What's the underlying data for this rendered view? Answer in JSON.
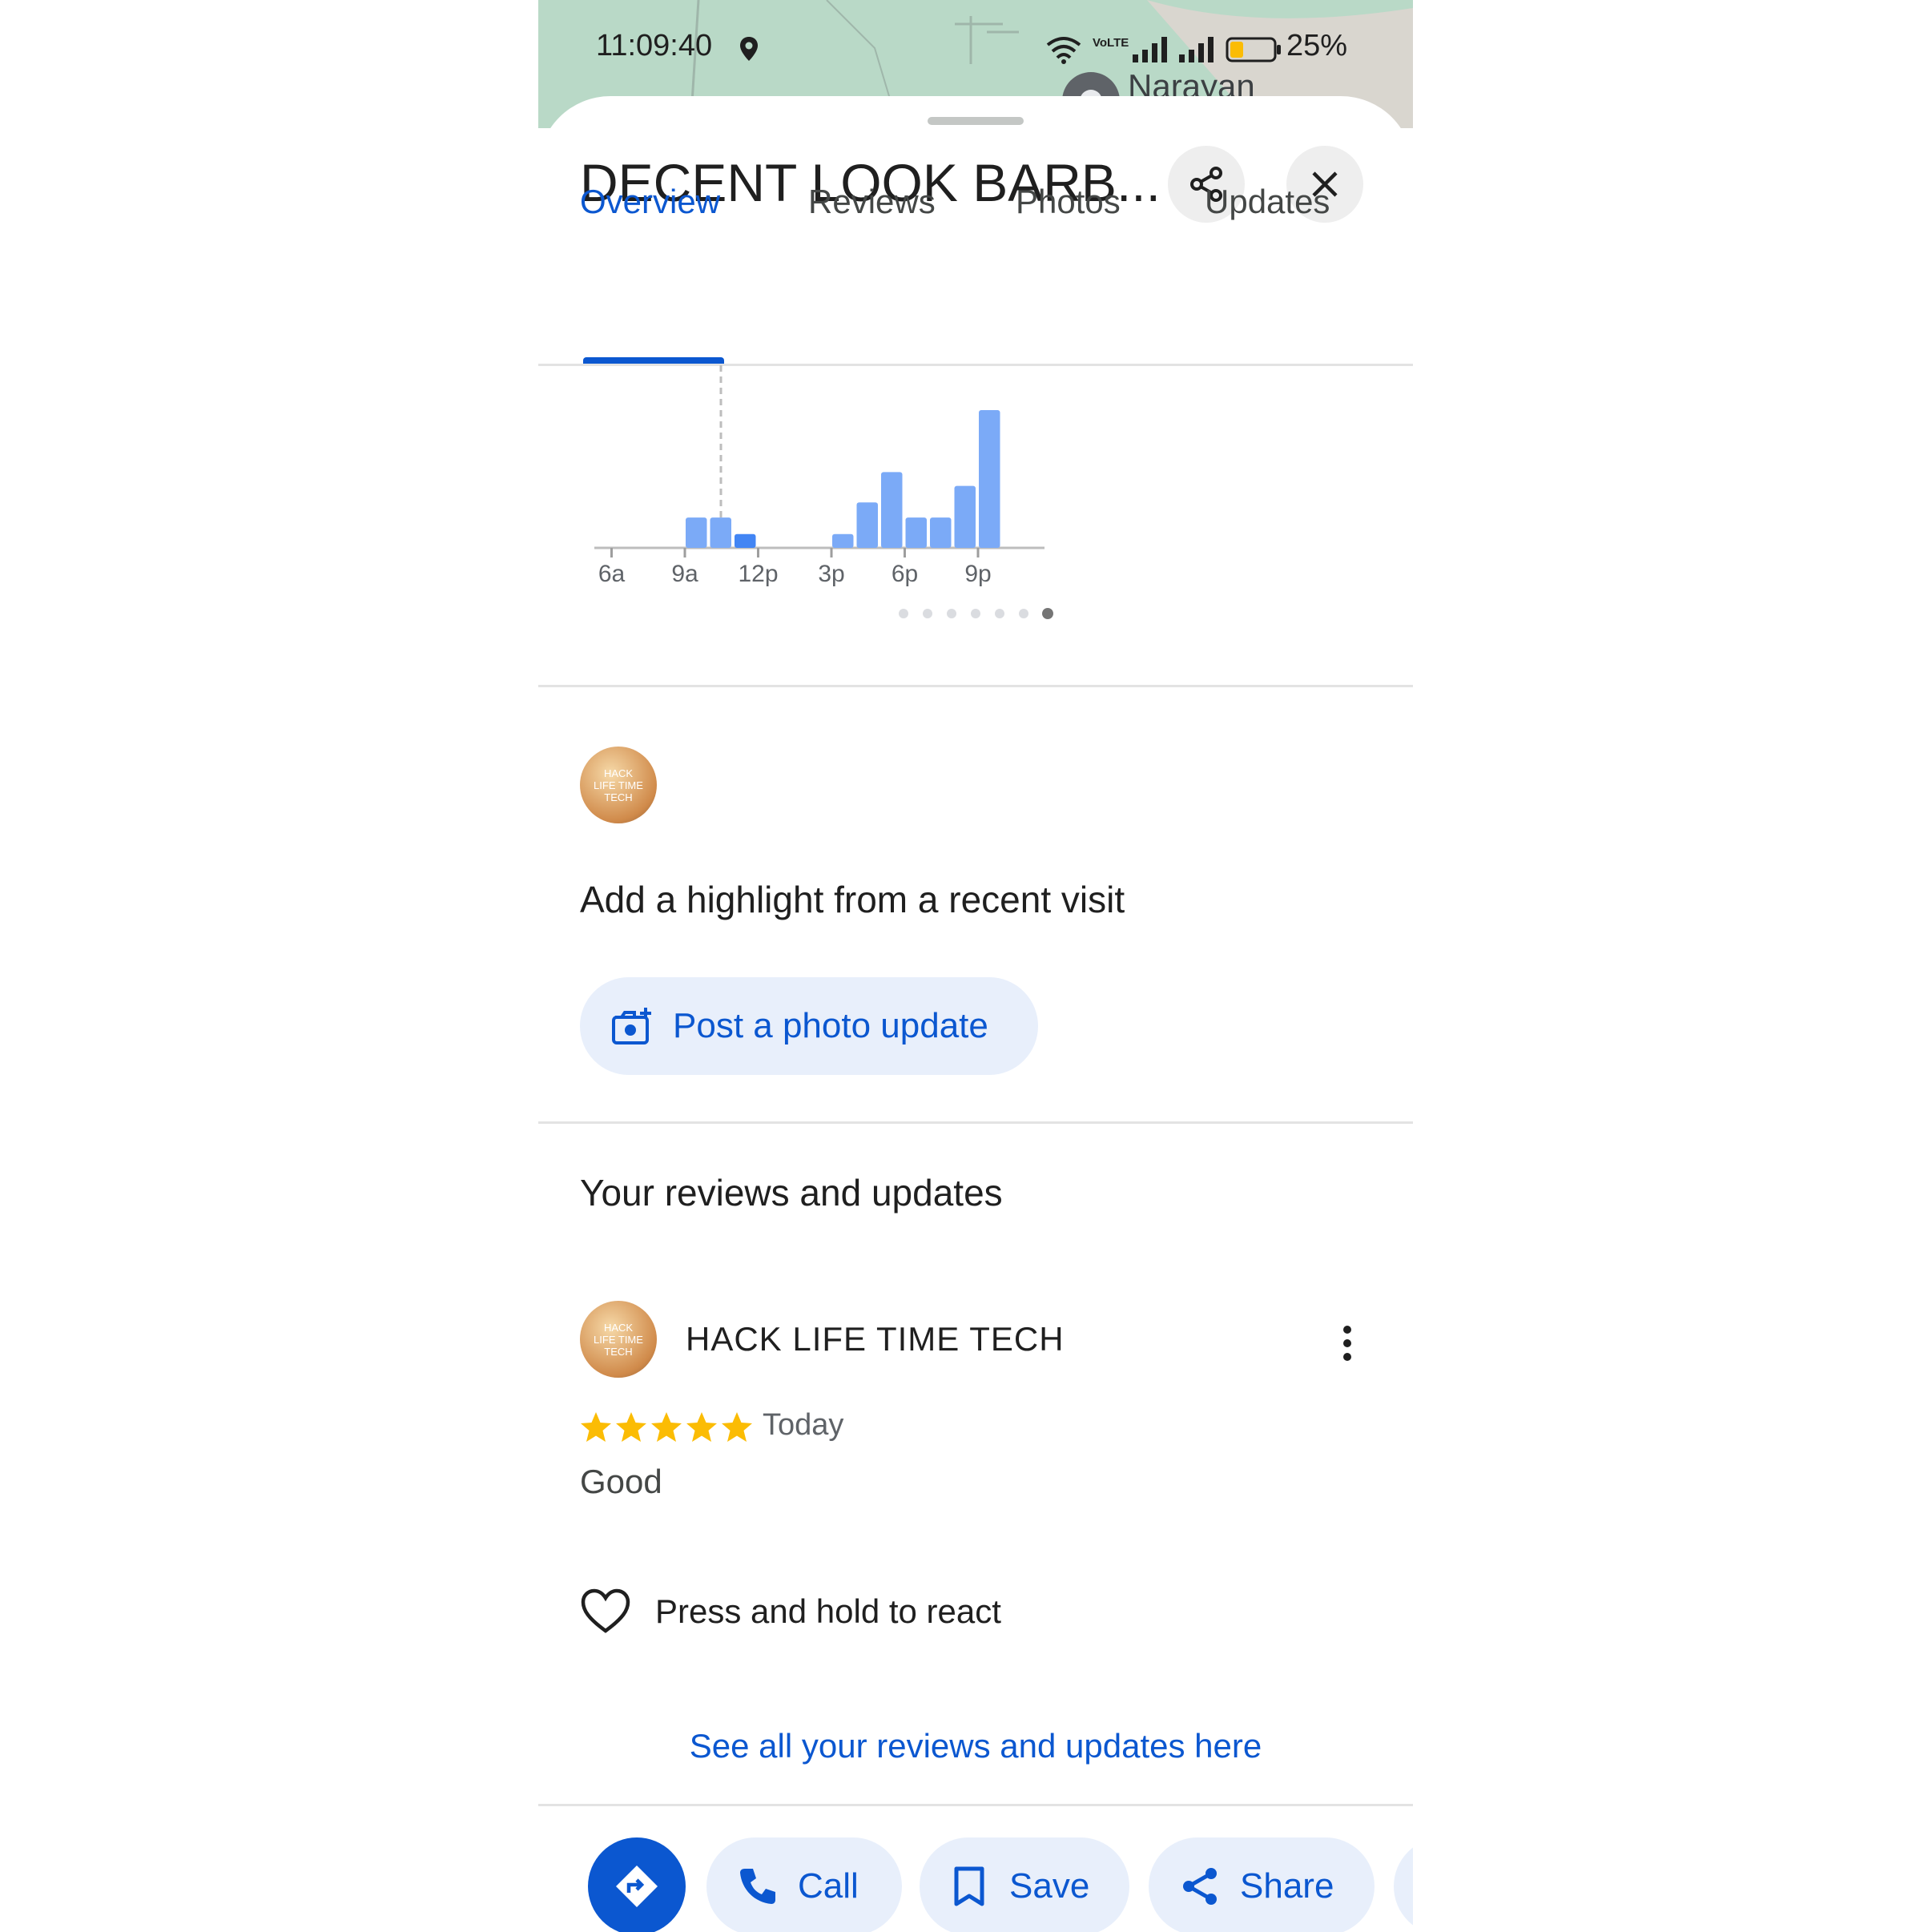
{
  "status_bar": {
    "time": "11:09:40",
    "battery": "25%",
    "network_label": "VoLTE"
  },
  "map": {
    "place_label": "Narayan Residency"
  },
  "header": {
    "title": "DECENT LOOK BARB..."
  },
  "tabs": [
    {
      "label": "Overview",
      "active": true
    },
    {
      "label": "Reviews",
      "active": false
    },
    {
      "label": "Photos",
      "active": false
    },
    {
      "label": "Updates",
      "active": false
    }
  ],
  "chart_data": {
    "type": "bar",
    "title": "",
    "xlabel": "",
    "ylabel": "",
    "tick_labels": [
      "6a",
      "9a",
      "12p",
      "3p",
      "6p",
      "9p"
    ],
    "x": [
      "9a",
      "10a",
      "11a",
      "3p",
      "4p",
      "5p",
      "6p",
      "7p",
      "8p",
      "9p"
    ],
    "values": [
      22,
      22,
      10,
      10,
      33,
      55,
      22,
      22,
      45,
      100
    ],
    "current_hour": "11a",
    "ylim": [
      0,
      100
    ],
    "grid": false,
    "pager": {
      "count": 7,
      "active_index": 6
    }
  },
  "highlight": {
    "avatar_text": "HACK LIFE TIME TECH",
    "heading": "Add a highlight from a recent visit",
    "post_button": "Post a photo update"
  },
  "reviews": {
    "heading": "Your reviews and updates",
    "author": "HACK LIFE TIME TECH",
    "rating": 5,
    "date": "Today",
    "text": "Good",
    "react_label": "Press and hold to react",
    "see_all": "See all your reviews and updates here"
  },
  "actions": {
    "call": "Call",
    "save": "Save",
    "share": "Share"
  },
  "colors": {
    "accent": "#0b57d0",
    "bar": "#7baaf7",
    "bar_current": "#4285f4",
    "star": "#fbbc04",
    "pill_bg": "#e8effb"
  }
}
